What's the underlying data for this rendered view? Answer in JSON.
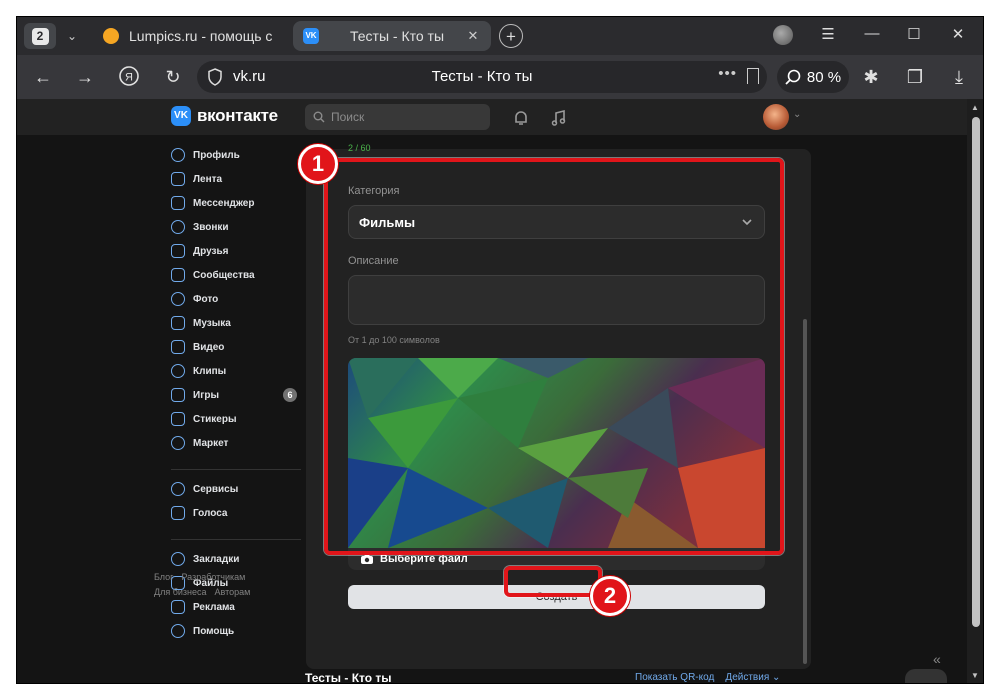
{
  "browser": {
    "tab_count": "2",
    "tabs": [
      {
        "title": "Lumpics.ru - помощь с ком",
        "active": false
      },
      {
        "title": "Тесты - Кто ты",
        "active": true
      }
    ],
    "address": {
      "domain": "vk.ru",
      "page_title": "Тесты - Кто ты"
    },
    "zoom": "80 %"
  },
  "vk": {
    "logo_text": "вконтакте",
    "search_placeholder": "Поиск",
    "nav": [
      {
        "label": "Профиль",
        "icon": "profile-icon"
      },
      {
        "label": "Лента",
        "icon": "feed-icon"
      },
      {
        "label": "Мессенджер",
        "icon": "messenger-icon"
      },
      {
        "label": "Звонки",
        "icon": "calls-icon"
      },
      {
        "label": "Друзья",
        "icon": "friends-icon"
      },
      {
        "label": "Сообщества",
        "icon": "communities-icon"
      },
      {
        "label": "Фото",
        "icon": "photo-icon"
      },
      {
        "label": "Музыка",
        "icon": "music-icon"
      },
      {
        "label": "Видео",
        "icon": "video-icon"
      },
      {
        "label": "Клипы",
        "icon": "clips-icon"
      },
      {
        "label": "Игры",
        "icon": "games-icon",
        "badge": "6"
      },
      {
        "label": "Стикеры",
        "icon": "stickers-icon"
      },
      {
        "label": "Маркет",
        "icon": "market-icon"
      }
    ],
    "nav2": [
      {
        "label": "Сервисы",
        "icon": "services-icon"
      },
      {
        "label": "Голоса",
        "icon": "votes-icon"
      }
    ],
    "nav3": [
      {
        "label": "Закладки",
        "icon": "bookmarks-icon"
      },
      {
        "label": "Файлы",
        "icon": "files-icon"
      },
      {
        "label": "Реклама",
        "icon": "ads-icon"
      },
      {
        "label": "Помощь",
        "icon": "help-icon"
      }
    ],
    "footer": [
      "Блог",
      "Разработчикам",
      "Для бизнеса",
      "Авторам"
    ]
  },
  "form": {
    "top_counter": "2 / 60",
    "category_label": "Категория",
    "category_value": "Фильмы",
    "description_label": "Описание",
    "description_hint": "От 1 до 100 символов",
    "choose_file_label": "Выберите файл",
    "create_button": "Создать"
  },
  "bottom": {
    "app_title": "Тесты - Кто ты",
    "qr_link": "Показать QR-код",
    "actions_link": "Действия"
  },
  "annotations": {
    "badge_1": "1",
    "badge_2": "2",
    "highlight_color": "#e1151a"
  }
}
